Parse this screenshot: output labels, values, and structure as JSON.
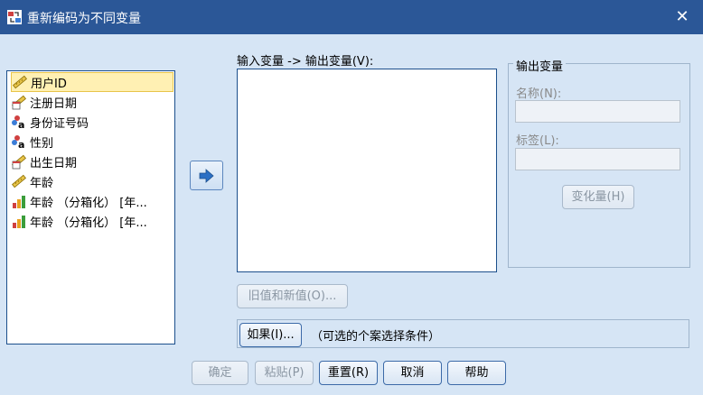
{
  "window": {
    "title": "重新编码为不同变量",
    "close_glyph": "✕"
  },
  "variables": [
    {
      "label": "用户ID",
      "icon": "ruler-scale-icon",
      "selected": true
    },
    {
      "label": "注册日期",
      "icon": "date-ruler-icon",
      "selected": false
    },
    {
      "label": "身份证号码",
      "icon": "nominal-string-icon",
      "selected": false
    },
    {
      "label": "性别",
      "icon": "nominal-string-icon",
      "selected": false
    },
    {
      "label": "出生日期",
      "icon": "date-ruler-icon",
      "selected": false
    },
    {
      "label": "年龄",
      "icon": "ruler-scale-icon",
      "selected": false
    },
    {
      "label": "年龄 （分箱化） [年...",
      "icon": "ordinal-bars-icon",
      "selected": false
    },
    {
      "label": "年龄 （分箱化） [年...",
      "icon": "ordinal-bars-icon",
      "selected": false
    }
  ],
  "io_box": {
    "label": "输入变量 -> 输出变量(V):"
  },
  "output_group": {
    "title": "输出变量",
    "name_label": "名称(N):",
    "label_label": "标签(L):",
    "change_button": "变化量(H)"
  },
  "old_new_button": "旧值和新值(O)...",
  "condition": {
    "if_button": "如果(I)...",
    "text": "（可选的个案选择条件）"
  },
  "footer": {
    "ok": "确定",
    "paste": "粘贴(P)",
    "reset": "重置(R)",
    "cancel": "取消",
    "help": "帮助"
  },
  "colors": {
    "titlebar": "#2b5797",
    "client": "#d6e5f5",
    "selection": "#fff0b3"
  }
}
